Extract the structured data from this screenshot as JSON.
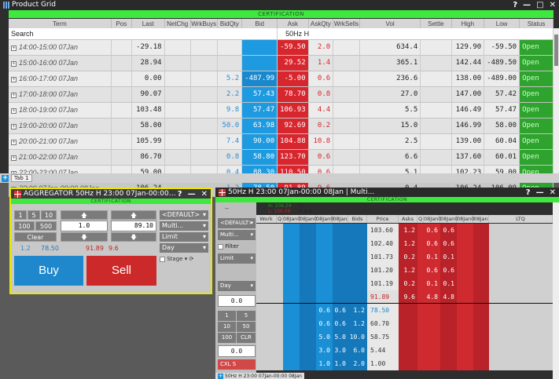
{
  "product_grid": {
    "title": "Product Grid",
    "certification": "CERTIFICATION",
    "controls": {
      "help": "?",
      "minimize": "—",
      "maximize": "□",
      "close": "✕"
    },
    "columns": [
      "Term",
      "Pos",
      "Last",
      "NetChg",
      "WrkBuys",
      "BidQty",
      "Bid",
      "Ask",
      "AskQty",
      "WrkSells",
      "Vol",
      "Settle",
      "High",
      "Low",
      "Status"
    ],
    "search_label": "Search",
    "product_label": "50Hz H",
    "rows": [
      {
        "term": "14:00-15:00 07Jan",
        "last": "-29.18",
        "bidqty": "",
        "bid": "",
        "ask": "-59.50",
        "askqty": "2.0",
        "vol": "634.4",
        "high": "129.90",
        "low": "-59.50",
        "status": "Open"
      },
      {
        "term": "15:00-16:00 07Jan",
        "last": "28.94",
        "bidqty": "",
        "bid": "",
        "ask": "29.52",
        "askqty": "1.4",
        "vol": "365.1",
        "high": "142.44",
        "low": "-489.50",
        "status": "Open"
      },
      {
        "term": "16:00-17:00 07Jan",
        "last": "0.00",
        "bidqty": "5.2",
        "bid": "-487.99",
        "ask": "-5.00",
        "askqty": "0.6",
        "vol": "236.6",
        "high": "138.00",
        "low": "-489.00",
        "status": "Open"
      },
      {
        "term": "17:00-18:00 07Jan",
        "last": "90.07",
        "bidqty": "2.2",
        "bid": "57.43",
        "ask": "78.70",
        "askqty": "0.8",
        "vol": "27.0",
        "high": "147.00",
        "low": "57.42",
        "status": "Open"
      },
      {
        "term": "18:00-19:00 07Jan",
        "last": "103.48",
        "bidqty": "9.8",
        "bid": "57.47",
        "ask": "106.93",
        "askqty": "4.4",
        "vol": "5.5",
        "high": "146.49",
        "low": "57.47",
        "status": "Open"
      },
      {
        "term": "19:00-20:00 07Jan",
        "last": "58.00",
        "bidqty": "50.0",
        "bid": "63.98",
        "ask": "92.69",
        "askqty": "0.2",
        "vol": "15.0",
        "high": "146.99",
        "low": "58.00",
        "status": "Open"
      },
      {
        "term": "20:00-21:00 07Jan",
        "last": "105.99",
        "bidqty": "7.4",
        "bid": "90.00",
        "ask": "104.88",
        "askqty": "10.8",
        "vol": "2.5",
        "high": "139.00",
        "low": "60.04",
        "status": "Open"
      },
      {
        "term": "21:00-22:00 07Jan",
        "last": "86.70",
        "bidqty": "0.8",
        "bid": "58.80",
        "ask": "123.70",
        "askqty": "0.6",
        "vol": "6.6",
        "high": "137.60",
        "low": "60.01",
        "status": "Open"
      },
      {
        "term": "22:00-23:00 07Jan",
        "last": "59.00",
        "bidqty": "0.4",
        "bid": "88.30",
        "ask": "110.50",
        "askqty": "0.6",
        "vol": "5.1",
        "high": "102.23",
        "low": "59.00",
        "status": "Open"
      },
      {
        "term": "23:00 07Jan-00:00 08Jan",
        "last": "106.24",
        "bidqty": "1.2",
        "bid": "78.50",
        "ask": "91.89",
        "askqty": "9.6",
        "vol": "0.4",
        "high": "106.24",
        "low": "106.09",
        "status": "Open"
      }
    ],
    "tab_label": "Tab 1"
  },
  "aggregator": {
    "title": "AGGREGATOR 50Hz H 23:00 07Jan-00:00 08Ja...",
    "certification": "CERTIFICATION",
    "controls": {
      "help": "?",
      "minimize": "—",
      "close": "✕"
    },
    "qty_buttons": [
      "1",
      "5",
      "10",
      "100",
      "500"
    ],
    "clear_label": "Clear",
    "qty_value": "1.0",
    "price_value": "89.10",
    "up_arrow": "🡅",
    "down_arrow": "🡇",
    "account_dd": "<DEFAULT>",
    "multi_dd": "Multi...",
    "order_type_dd": "Limit",
    "tif_dd": "Day",
    "bid_qty": "1.2",
    "bid": "78.50",
    "ask": "91.89",
    "ask_qty": "9.6",
    "stage_label": "Stage",
    "buy_label": "Buy",
    "sell_label": "Sell"
  },
  "ladder": {
    "title": "50Hz H 23:00 07Jan-00:00 08Jan | Multi...",
    "certification": "CERTIFICATION",
    "controls": {
      "help": "?",
      "minimize": "—",
      "close": "✕"
    },
    "account_dd": "<DEFAULT>",
    "multi_dd": "Multi...",
    "filter_label": "Filter",
    "order_type_dd": "Limit",
    "tif_dd": "Day",
    "price_value": "0.0",
    "qty_value": "0.0",
    "qty_buttons": [
      "1",
      "5",
      "10",
      "50",
      "100",
      "CLR"
    ],
    "cxl_label": "CXL S",
    "dash": "--",
    "info": {
      "h": "H: 106.24",
      "l": "L: 106.09",
      "o": "O:",
      "v": "V: 0.4"
    },
    "headers": [
      "Work",
      "Q",
      "08Jan0",
      "08Jan0",
      "08Jan0",
      "08Jan",
      "Bids",
      "Price",
      "Asks",
      "Q",
      "08Jan0",
      "08Jan0",
      "08Jan0",
      "08Jan",
      "LTQ"
    ],
    "rows": [
      {
        "price": "103.60",
        "asks": [
          "1.2",
          "0.6",
          "0.6"
        ]
      },
      {
        "price": "102.40",
        "asks": [
          "1.2",
          "0.6",
          "0.6"
        ]
      },
      {
        "price": "101.73",
        "asks": [
          "0.2",
          "0.1",
          "0.1"
        ]
      },
      {
        "price": "101.20",
        "asks": [
          "1.2",
          "0.6",
          "0.6"
        ]
      },
      {
        "price": "101.19",
        "asks": [
          "0.2",
          "0.1",
          "0.1"
        ]
      },
      {
        "price": "91.89",
        "asks": [
          "9.6",
          "4.8",
          "4.8"
        ]
      },
      {
        "price": "78.50",
        "bids": [
          "0.6",
          "0.6",
          "1.2"
        ]
      },
      {
        "price": "60.70",
        "bids": [
          "0.6",
          "0.6",
          "1.2"
        ]
      },
      {
        "price": "58.75",
        "bids": [
          "5.0",
          "5.0",
          "10.0"
        ]
      },
      {
        "price": "5.44",
        "bids": [
          "3.0",
          "3.0",
          "6.0"
        ]
      },
      {
        "price": "1.00",
        "bids": [
          "1.0",
          "1.0",
          "2.0"
        ]
      }
    ],
    "bottom_tab": "50Hz H 23:00 07Jan-00:00 08Jan"
  }
}
